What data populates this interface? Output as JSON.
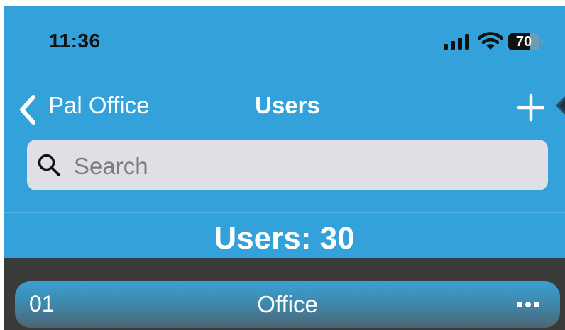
{
  "status_bar": {
    "time": "11:36",
    "battery_percent": "70",
    "battery_level": 0.7
  },
  "nav": {
    "back_label": "Pal Office",
    "title": "Users"
  },
  "search": {
    "placeholder": "Search"
  },
  "summary": {
    "users_count": "Users: 30"
  },
  "list": {
    "items": [
      {
        "number": "01",
        "name": "Office"
      }
    ]
  },
  "colors": {
    "header_bg": "#33a1da",
    "list_bg": "#3a3a3b",
    "search_bg": "#e0dfe3"
  },
  "icons": [
    "cellular-signal-icon",
    "wifi-icon",
    "battery-icon",
    "back-chevron-icon",
    "add-icon",
    "search-icon",
    "more-icon"
  ]
}
